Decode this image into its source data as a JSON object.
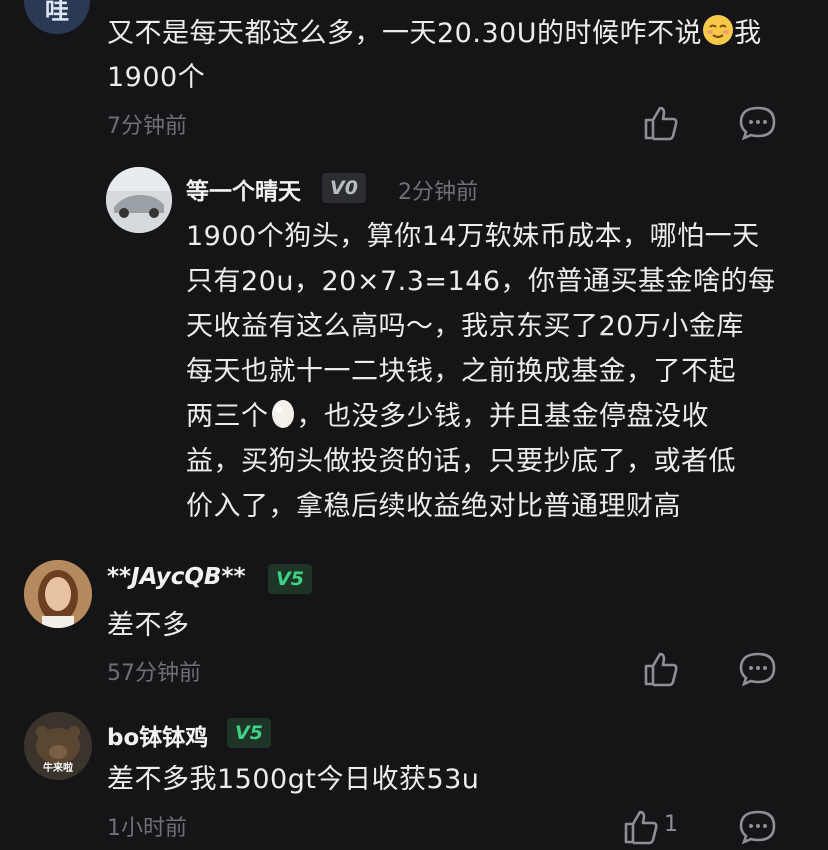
{
  "comments": [
    {
      "avatar_text": "哇",
      "text_line1": "又不是每天都这么多，一天20.30U的时候咋不说",
      "emoji": "relieved-face",
      "text_line1_end": "我",
      "text_line2": "1900个",
      "time": "7分钟前"
    },
    {
      "username": "等一个晴天",
      "level": "V0",
      "time": "2分钟前",
      "lines": [
        "1900个狗头，算你14万软妹币成本，哪怕一天",
        "只有20u，20×7.3=146，你普通买基金啥的每",
        "天收益有这么高吗～，我京东买了20万小金库",
        "每天也就十一二块钱，之前换成基金，了不起"
      ],
      "line5_start": "两三个",
      "line5_emoji": "egg",
      "line5_end": "，也没多少钱，并且基金停盘没收",
      "lines_after": [
        "益，买狗头做投资的话，只要抄底了，或者低",
        "价入了，拿稳后续收益绝对比普通理财高"
      ]
    },
    {
      "username": "**JAycQB**",
      "level": "V5",
      "text": "差不多",
      "time": "57分钟前"
    },
    {
      "username": "bo钵钵鸡",
      "level": "V5",
      "avatar_caption": "牛来啦",
      "text": "差不多我1500gt今日收获53u",
      "time": "1小时前",
      "like_count": "1"
    }
  ],
  "colors": {
    "background": "#151517",
    "text": "#ececec",
    "muted": "#6f7075",
    "v5_green": "#3ed286"
  }
}
